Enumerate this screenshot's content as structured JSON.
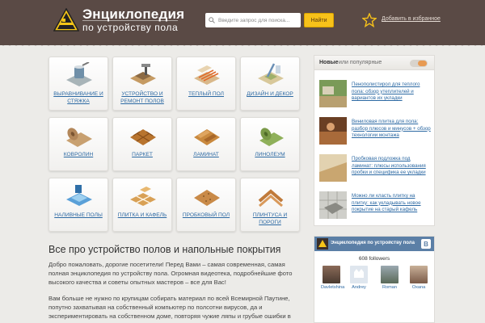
{
  "header": {
    "logo_title": "Энциклопедия",
    "logo_subtitle": "по устройству пола",
    "search_placeholder": "Введите запрос для поиска...",
    "search_button": "Найти",
    "favorites_link": "Добавить в избранное"
  },
  "tiles": [
    {
      "label": "ВЫРАВНИВАНИЕ И СТЯЖКА"
    },
    {
      "label": "УСТРОЙСТВО И РЕМОНТ ПОЛОВ"
    },
    {
      "label": "ТЕПЛЫЙ ПОЛ"
    },
    {
      "label": "ДИЗАЙН И ДЕКОР"
    },
    {
      "label": "КОВРОЛИН"
    },
    {
      "label": "ПАРКЕТ"
    },
    {
      "label": "ЛАМИНАТ"
    },
    {
      "label": "ЛИНОЛЕУМ"
    },
    {
      "label": "НАЛИВНЫЕ ПОЛЫ"
    },
    {
      "label": "ПЛИТКА И КАФЕЛЬ"
    },
    {
      "label": "ПРОБКОВЫЙ ПОЛ"
    },
    {
      "label": "ПЛИНТУСА И ПОРОГИ"
    }
  ],
  "content": {
    "heading": "Все про устройство полов и напольные покрытия",
    "intro": "Добро пожаловать, дорогие посетители! Перед Вами – самая современная, самая полная энциклопедия по устройству пола. Огромная видеотека, подробнейшие фото высокого качества и советы опытных мастеров – все для Вас!",
    "intro2": "Вам больше не нужно по крупицам собирать материал по всей Всемирной Паутине, попутно захватывая на собственный компьютер по полсотни вирусов, да и экспериментировать на собственном доме, повторяя чужие ляпы и грубые ошибки в"
  },
  "sidebar": {
    "tab_new": "Новые",
    "tab_rest": "или популярные",
    "news": [
      {
        "title": "Пенополистирол для теплого пола: обзор утеплителей и вариантов их укладки"
      },
      {
        "title": "Виниловая плитка для пола: разбор плюсов и минусов + обзор технологии монтажа"
      },
      {
        "title": "Пробковая подложка под ламинат: плюсы использования пробки и специфика ее укладки"
      },
      {
        "title": "Можно ли класть плитку на плитку: как укладывать новое покрытие на старый кафель"
      }
    ]
  },
  "vk_widget": {
    "group_name": "Энциклопедия по устройству пола - Ро...",
    "button": "B",
    "followers": "608 followers",
    "members": [
      {
        "name": "Davletshina"
      },
      {
        "name": "Andrey"
      },
      {
        "name": "Roman"
      },
      {
        "name": "Oxana"
      }
    ]
  },
  "colors": {
    "header": "#5a4a45",
    "accent_button": "#f7c21a",
    "link": "#2c69a3",
    "vk_header": "#5b7fa6"
  }
}
